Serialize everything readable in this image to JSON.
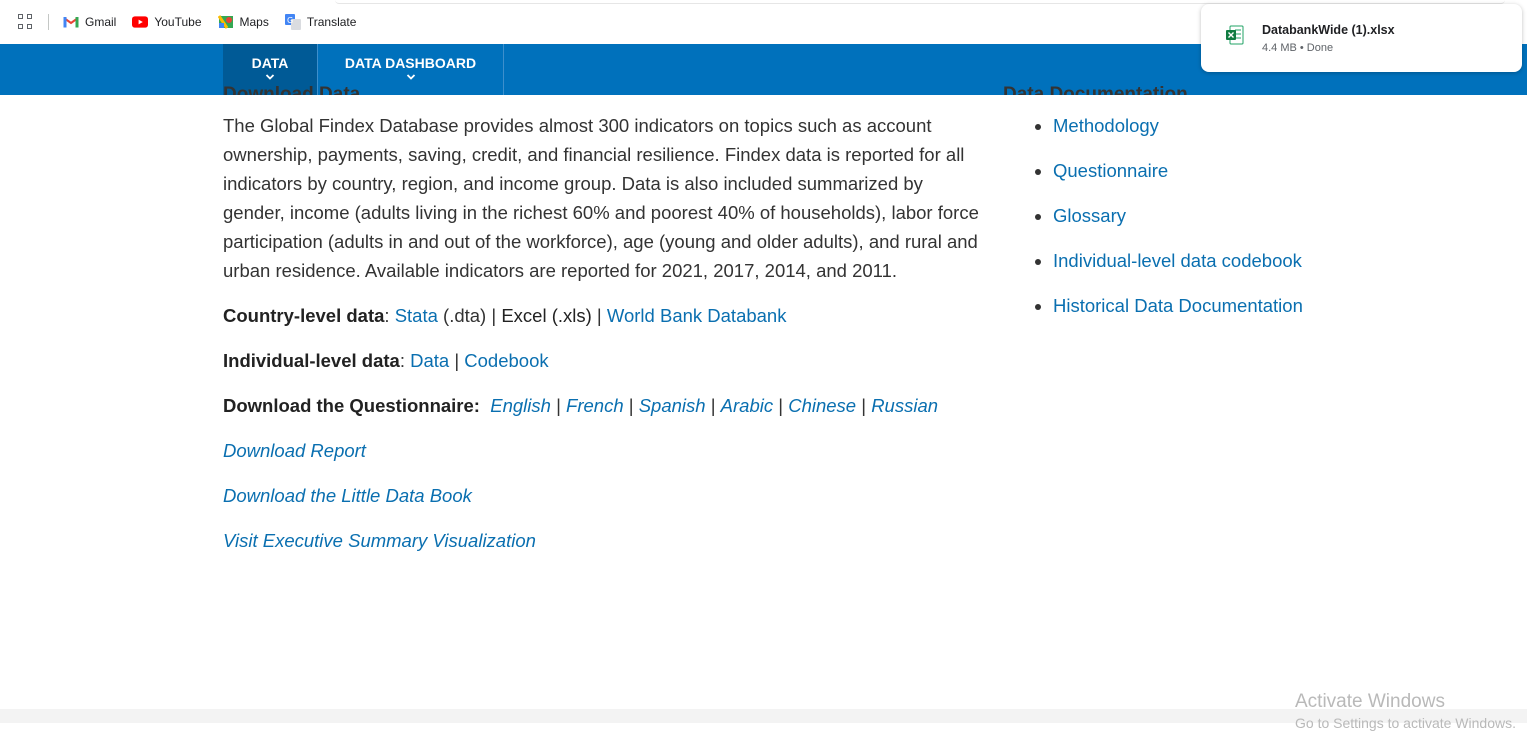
{
  "bookmarks": [
    {
      "label": "Gmail",
      "icon": "gmail-icon"
    },
    {
      "label": "YouTube",
      "icon": "youtube-icon"
    },
    {
      "label": "Maps",
      "icon": "maps-icon"
    },
    {
      "label": "Translate",
      "icon": "translate-icon"
    }
  ],
  "nav": {
    "tabs": [
      {
        "label": "DATA"
      },
      {
        "label": "DATA DASHBOARD"
      }
    ],
    "color": "#0071bc"
  },
  "main": {
    "heading": "Download Data",
    "intro": "The Global Findex Database provides almost 300 indicators on topics such as account ownership, payments, saving, credit, and financial resilience. Findex data is reported for all indicators by country, region, and income group. Data is also included summarized by gender, income (adults living in the richest 60% and poorest 40% of households), labor force participation (adults in and out of the workforce), age (young and older adults), and rural and urban residence. Available indicators are reported for 2021, 2017, 2014, and 2011.",
    "country_level": {
      "label": "Country-level data",
      "stata": "Stata",
      "stata_ext": "(.dta)",
      "excel": "Excel (.xls)",
      "databank": "World Bank Databank"
    },
    "individual_level": {
      "label": "Individual-level data",
      "data": "Data",
      "codebook": "Codebook"
    },
    "questionnaire": {
      "label": "Download the Questionnaire:",
      "languages": [
        "English",
        "French",
        "Spanish",
        "Arabic",
        "Chinese",
        "Russian"
      ]
    },
    "report": "Download Report",
    "little_book": "Download the Little Data Book",
    "exec_summary": "Visit Executive Summary Visualization"
  },
  "sidebar": {
    "heading": "Data Documentation",
    "items": [
      {
        "label": "Methodology"
      },
      {
        "label": "Questionnaire"
      },
      {
        "label": "Glossary"
      },
      {
        "label": "Individual-level data codebook"
      },
      {
        "label": "Historical Data Documentation"
      }
    ]
  },
  "download": {
    "filename": "DatabankWide (1).xlsx",
    "meta": "4.4 MB • Done"
  },
  "watermark": {
    "title": "Activate Windows",
    "subtitle": "Go to Settings to activate Windows."
  },
  "colors": {
    "link": "#0a6fb0",
    "nav_active": "#005a96"
  }
}
